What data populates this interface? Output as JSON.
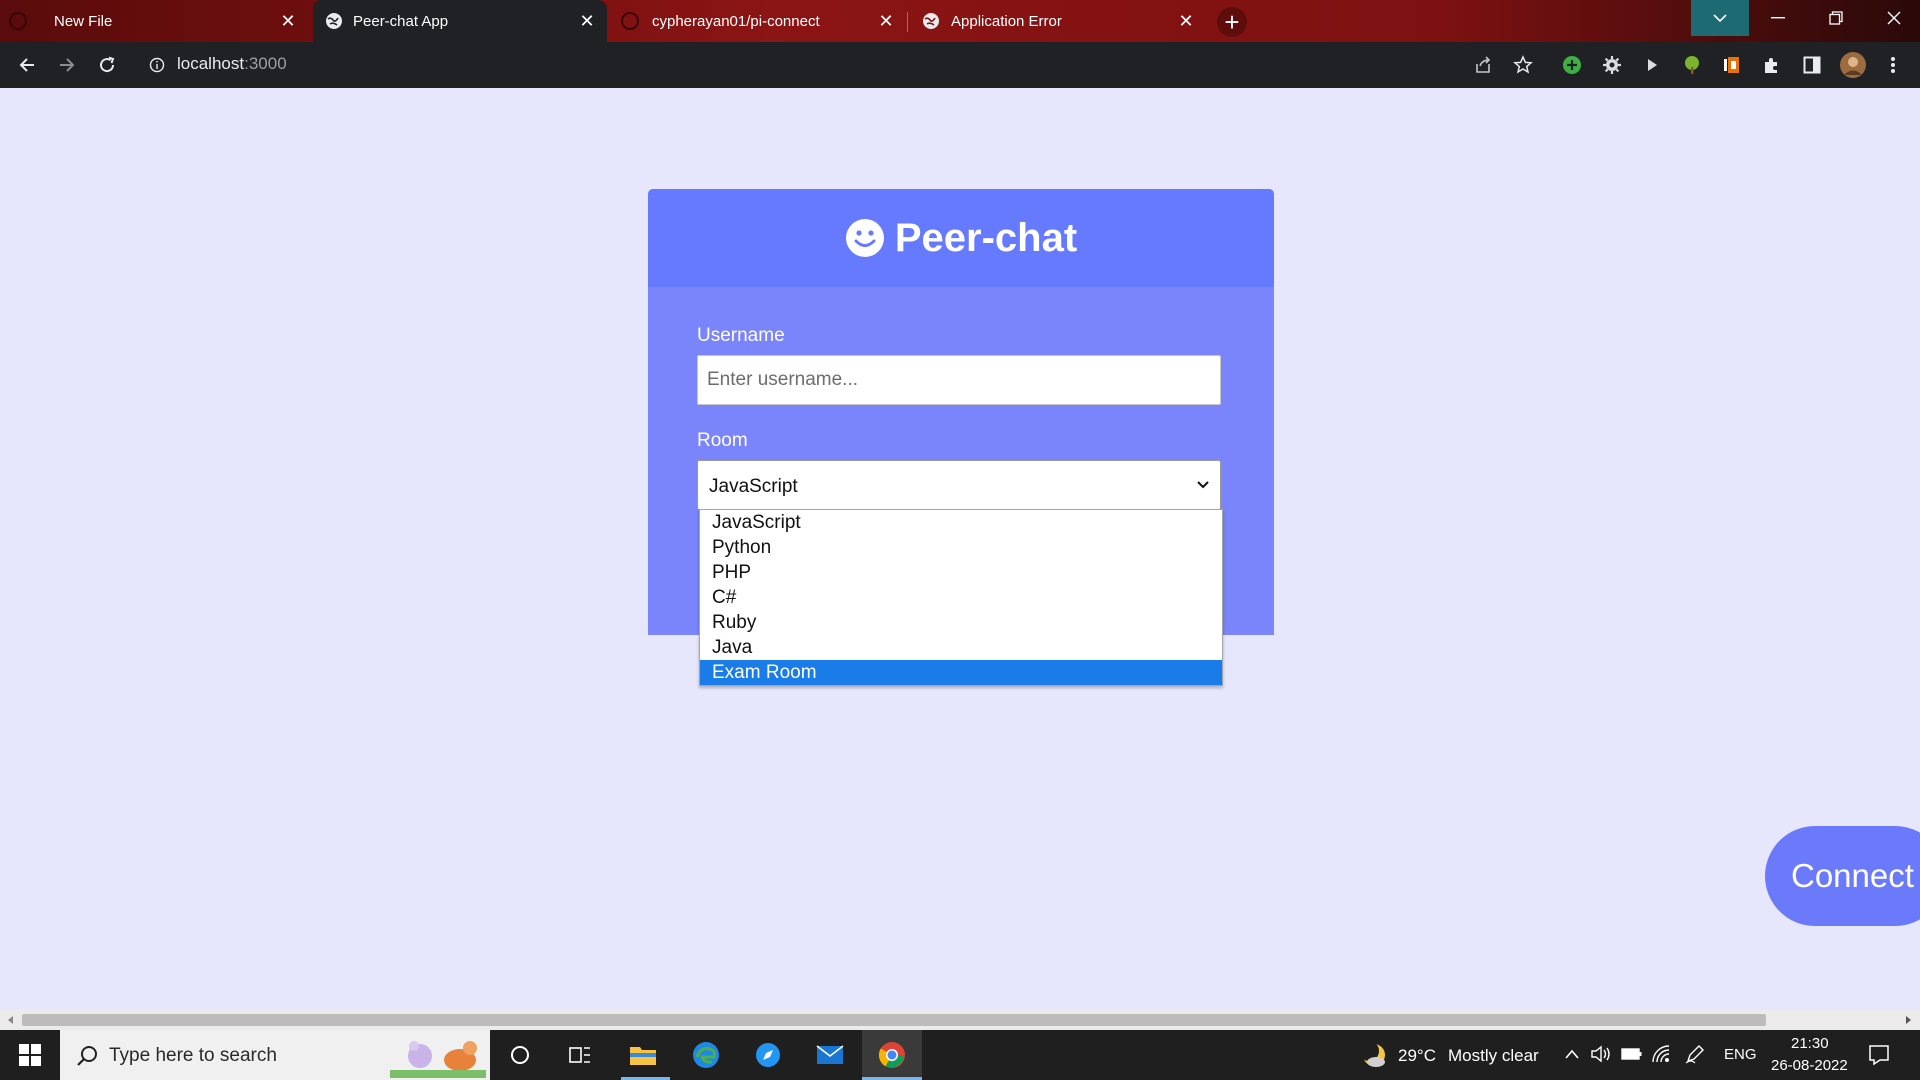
{
  "browser": {
    "tabs": [
      {
        "title": "New File",
        "favicon": "github-icon",
        "active": false
      },
      {
        "title": "Peer-chat App",
        "favicon": "globe-icon",
        "active": true
      },
      {
        "title": "cypherayan01/pi-connect",
        "favicon": "github-icon",
        "active": false
      },
      {
        "title": "Application Error",
        "favicon": "globe-icon",
        "active": false
      }
    ],
    "new_tab_label": "+",
    "url_host": "localhost",
    "url_port": ":3000"
  },
  "page": {
    "brand": "Peer-chat",
    "username_label": "Username",
    "username_placeholder": "Enter username...",
    "room_label": "Room",
    "room_selected": "JavaScript",
    "room_options": [
      "JavaScript",
      "Python",
      "PHP",
      "C#",
      "Ruby",
      "Java",
      "Exam Room"
    ],
    "highlighted_option": "Exam Room",
    "connect_button": "Connect",
    "accent_color": "#667aff"
  },
  "taskbar": {
    "search_placeholder": "Type here to search",
    "weather_temp": "29°C",
    "weather_desc": "Mostly clear",
    "language": "ENG",
    "time": "21:30",
    "date": "26-08-2022"
  }
}
